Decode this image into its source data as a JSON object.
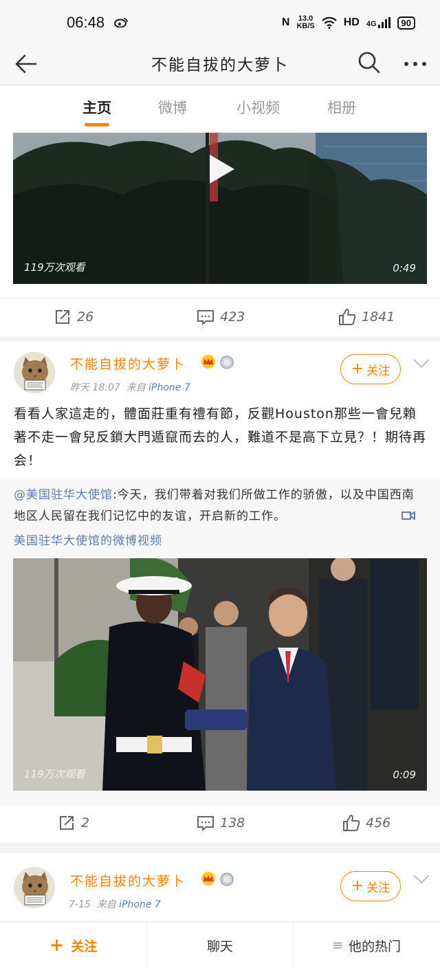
{
  "status_bar": {
    "time": "06:48",
    "net_speed_value": "13.0",
    "net_speed_unit": "KB/S",
    "hd": "HD",
    "network": "4G",
    "battery": "90"
  },
  "navbar": {
    "title": "不能自拔的大萝卜"
  },
  "tabs": [
    {
      "label": "主页",
      "active": true
    },
    {
      "label": "微博",
      "active": false
    },
    {
      "label": "小视频",
      "active": false
    },
    {
      "label": "相册",
      "active": false
    }
  ],
  "post1": {
    "video": {
      "views": "119万次观看",
      "duration": "0:49"
    },
    "actions": {
      "reposts": "26",
      "comments": "423",
      "likes": "1841"
    }
  },
  "post2": {
    "username": "不能自拔的大萝卜",
    "time": "昨天 18:07",
    "source_prefix": "来自",
    "device": "iPhone 7",
    "follow_label": "关注",
    "text": "看看人家這走的，體面莊重有禮有節，反觀Houston那些一會兒賴著不走一會兒反鎖大門遁竄而去的人，難道不是高下立見？！期待再会！",
    "repost": {
      "mention": "@美国驻华大使馆",
      "text": ":今天，我们带着对我们所做工作的骄傲，以及中国西南地区人民留在我们记忆中的友谊，开启新的工作。",
      "link": "美国驻华大使馆的微博视频"
    },
    "video": {
      "views": "119万次观看",
      "duration": "0:09"
    },
    "actions": {
      "reposts": "2",
      "comments": "138",
      "likes": "456"
    }
  },
  "post3": {
    "username": "不能自拔的大萝卜",
    "time": "7-15",
    "source_prefix": "来自",
    "device": "iPhone 7",
    "follow_label": "关注"
  },
  "bottom_bar": {
    "follow": "关注",
    "chat": "聊天",
    "hot": "他的热门"
  },
  "colors": {
    "accent": "#ff8200",
    "link": "#5d7ea8"
  }
}
